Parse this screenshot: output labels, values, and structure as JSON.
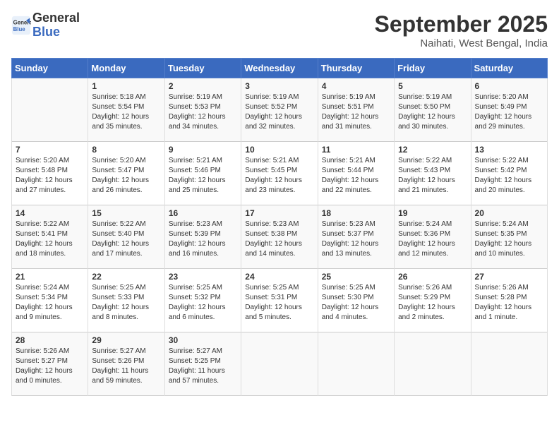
{
  "header": {
    "logo_line1": "General",
    "logo_line2": "Blue",
    "month": "September 2025",
    "location": "Naihati, West Bengal, India"
  },
  "weekdays": [
    "Sunday",
    "Monday",
    "Tuesday",
    "Wednesday",
    "Thursday",
    "Friday",
    "Saturday"
  ],
  "weeks": [
    [
      {
        "day": "",
        "text": ""
      },
      {
        "day": "1",
        "text": "Sunrise: 5:18 AM\nSunset: 5:54 PM\nDaylight: 12 hours\nand 35 minutes."
      },
      {
        "day": "2",
        "text": "Sunrise: 5:19 AM\nSunset: 5:53 PM\nDaylight: 12 hours\nand 34 minutes."
      },
      {
        "day": "3",
        "text": "Sunrise: 5:19 AM\nSunset: 5:52 PM\nDaylight: 12 hours\nand 32 minutes."
      },
      {
        "day": "4",
        "text": "Sunrise: 5:19 AM\nSunset: 5:51 PM\nDaylight: 12 hours\nand 31 minutes."
      },
      {
        "day": "5",
        "text": "Sunrise: 5:19 AM\nSunset: 5:50 PM\nDaylight: 12 hours\nand 30 minutes."
      },
      {
        "day": "6",
        "text": "Sunrise: 5:20 AM\nSunset: 5:49 PM\nDaylight: 12 hours\nand 29 minutes."
      }
    ],
    [
      {
        "day": "7",
        "text": "Sunrise: 5:20 AM\nSunset: 5:48 PM\nDaylight: 12 hours\nand 27 minutes."
      },
      {
        "day": "8",
        "text": "Sunrise: 5:20 AM\nSunset: 5:47 PM\nDaylight: 12 hours\nand 26 minutes."
      },
      {
        "day": "9",
        "text": "Sunrise: 5:21 AM\nSunset: 5:46 PM\nDaylight: 12 hours\nand 25 minutes."
      },
      {
        "day": "10",
        "text": "Sunrise: 5:21 AM\nSunset: 5:45 PM\nDaylight: 12 hours\nand 23 minutes."
      },
      {
        "day": "11",
        "text": "Sunrise: 5:21 AM\nSunset: 5:44 PM\nDaylight: 12 hours\nand 22 minutes."
      },
      {
        "day": "12",
        "text": "Sunrise: 5:22 AM\nSunset: 5:43 PM\nDaylight: 12 hours\nand 21 minutes."
      },
      {
        "day": "13",
        "text": "Sunrise: 5:22 AM\nSunset: 5:42 PM\nDaylight: 12 hours\nand 20 minutes."
      }
    ],
    [
      {
        "day": "14",
        "text": "Sunrise: 5:22 AM\nSunset: 5:41 PM\nDaylight: 12 hours\nand 18 minutes."
      },
      {
        "day": "15",
        "text": "Sunrise: 5:22 AM\nSunset: 5:40 PM\nDaylight: 12 hours\nand 17 minutes."
      },
      {
        "day": "16",
        "text": "Sunrise: 5:23 AM\nSunset: 5:39 PM\nDaylight: 12 hours\nand 16 minutes."
      },
      {
        "day": "17",
        "text": "Sunrise: 5:23 AM\nSunset: 5:38 PM\nDaylight: 12 hours\nand 14 minutes."
      },
      {
        "day": "18",
        "text": "Sunrise: 5:23 AM\nSunset: 5:37 PM\nDaylight: 12 hours\nand 13 minutes."
      },
      {
        "day": "19",
        "text": "Sunrise: 5:24 AM\nSunset: 5:36 PM\nDaylight: 12 hours\nand 12 minutes."
      },
      {
        "day": "20",
        "text": "Sunrise: 5:24 AM\nSunset: 5:35 PM\nDaylight: 12 hours\nand 10 minutes."
      }
    ],
    [
      {
        "day": "21",
        "text": "Sunrise: 5:24 AM\nSunset: 5:34 PM\nDaylight: 12 hours\nand 9 minutes."
      },
      {
        "day": "22",
        "text": "Sunrise: 5:25 AM\nSunset: 5:33 PM\nDaylight: 12 hours\nand 8 minutes."
      },
      {
        "day": "23",
        "text": "Sunrise: 5:25 AM\nSunset: 5:32 PM\nDaylight: 12 hours\nand 6 minutes."
      },
      {
        "day": "24",
        "text": "Sunrise: 5:25 AM\nSunset: 5:31 PM\nDaylight: 12 hours\nand 5 minutes."
      },
      {
        "day": "25",
        "text": "Sunrise: 5:25 AM\nSunset: 5:30 PM\nDaylight: 12 hours\nand 4 minutes."
      },
      {
        "day": "26",
        "text": "Sunrise: 5:26 AM\nSunset: 5:29 PM\nDaylight: 12 hours\nand 2 minutes."
      },
      {
        "day": "27",
        "text": "Sunrise: 5:26 AM\nSunset: 5:28 PM\nDaylight: 12 hours\nand 1 minute."
      }
    ],
    [
      {
        "day": "28",
        "text": "Sunrise: 5:26 AM\nSunset: 5:27 PM\nDaylight: 12 hours\nand 0 minutes."
      },
      {
        "day": "29",
        "text": "Sunrise: 5:27 AM\nSunset: 5:26 PM\nDaylight: 11 hours\nand 59 minutes."
      },
      {
        "day": "30",
        "text": "Sunrise: 5:27 AM\nSunset: 5:25 PM\nDaylight: 11 hours\nand 57 minutes."
      },
      {
        "day": "",
        "text": ""
      },
      {
        "day": "",
        "text": ""
      },
      {
        "day": "",
        "text": ""
      },
      {
        "day": "",
        "text": ""
      }
    ]
  ]
}
